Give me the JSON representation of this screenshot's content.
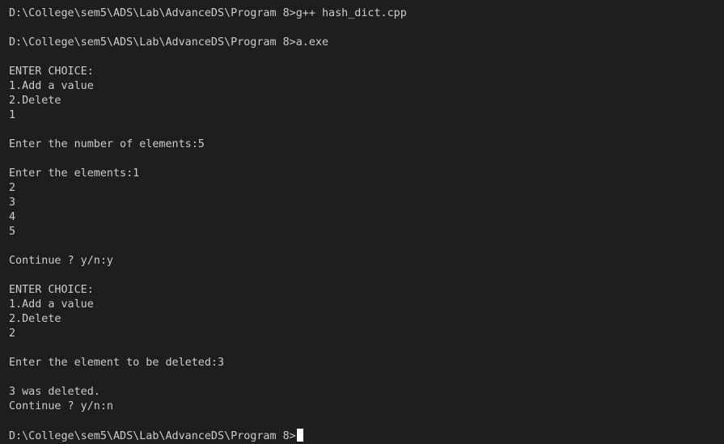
{
  "terminal": {
    "lines": [
      "D:\\College\\sem5\\ADS\\Lab\\AdvanceDS\\Program 8>g++ hash_dict.cpp",
      "",
      "D:\\College\\sem5\\ADS\\Lab\\AdvanceDS\\Program 8>a.exe",
      "",
      "ENTER CHOICE:",
      "1.Add a value",
      "2.Delete",
      "1",
      "",
      "Enter the number of elements:5",
      "",
      "Enter the elements:1",
      "2",
      "3",
      "4",
      "5",
      "",
      "Continue ? y/n:y",
      "",
      "ENTER CHOICE:",
      "1.Add a value",
      "2.Delete",
      "2",
      "",
      "Enter the element to be deleted:3",
      "",
      "3 was deleted.",
      "Continue ? y/n:n",
      "",
      "D:\\College\\sem5\\ADS\\Lab\\AdvanceDS\\Program 8>"
    ]
  },
  "colors": {
    "background": "#1e1e1e",
    "text": "#cccccc",
    "cursor": "#ffffff"
  }
}
